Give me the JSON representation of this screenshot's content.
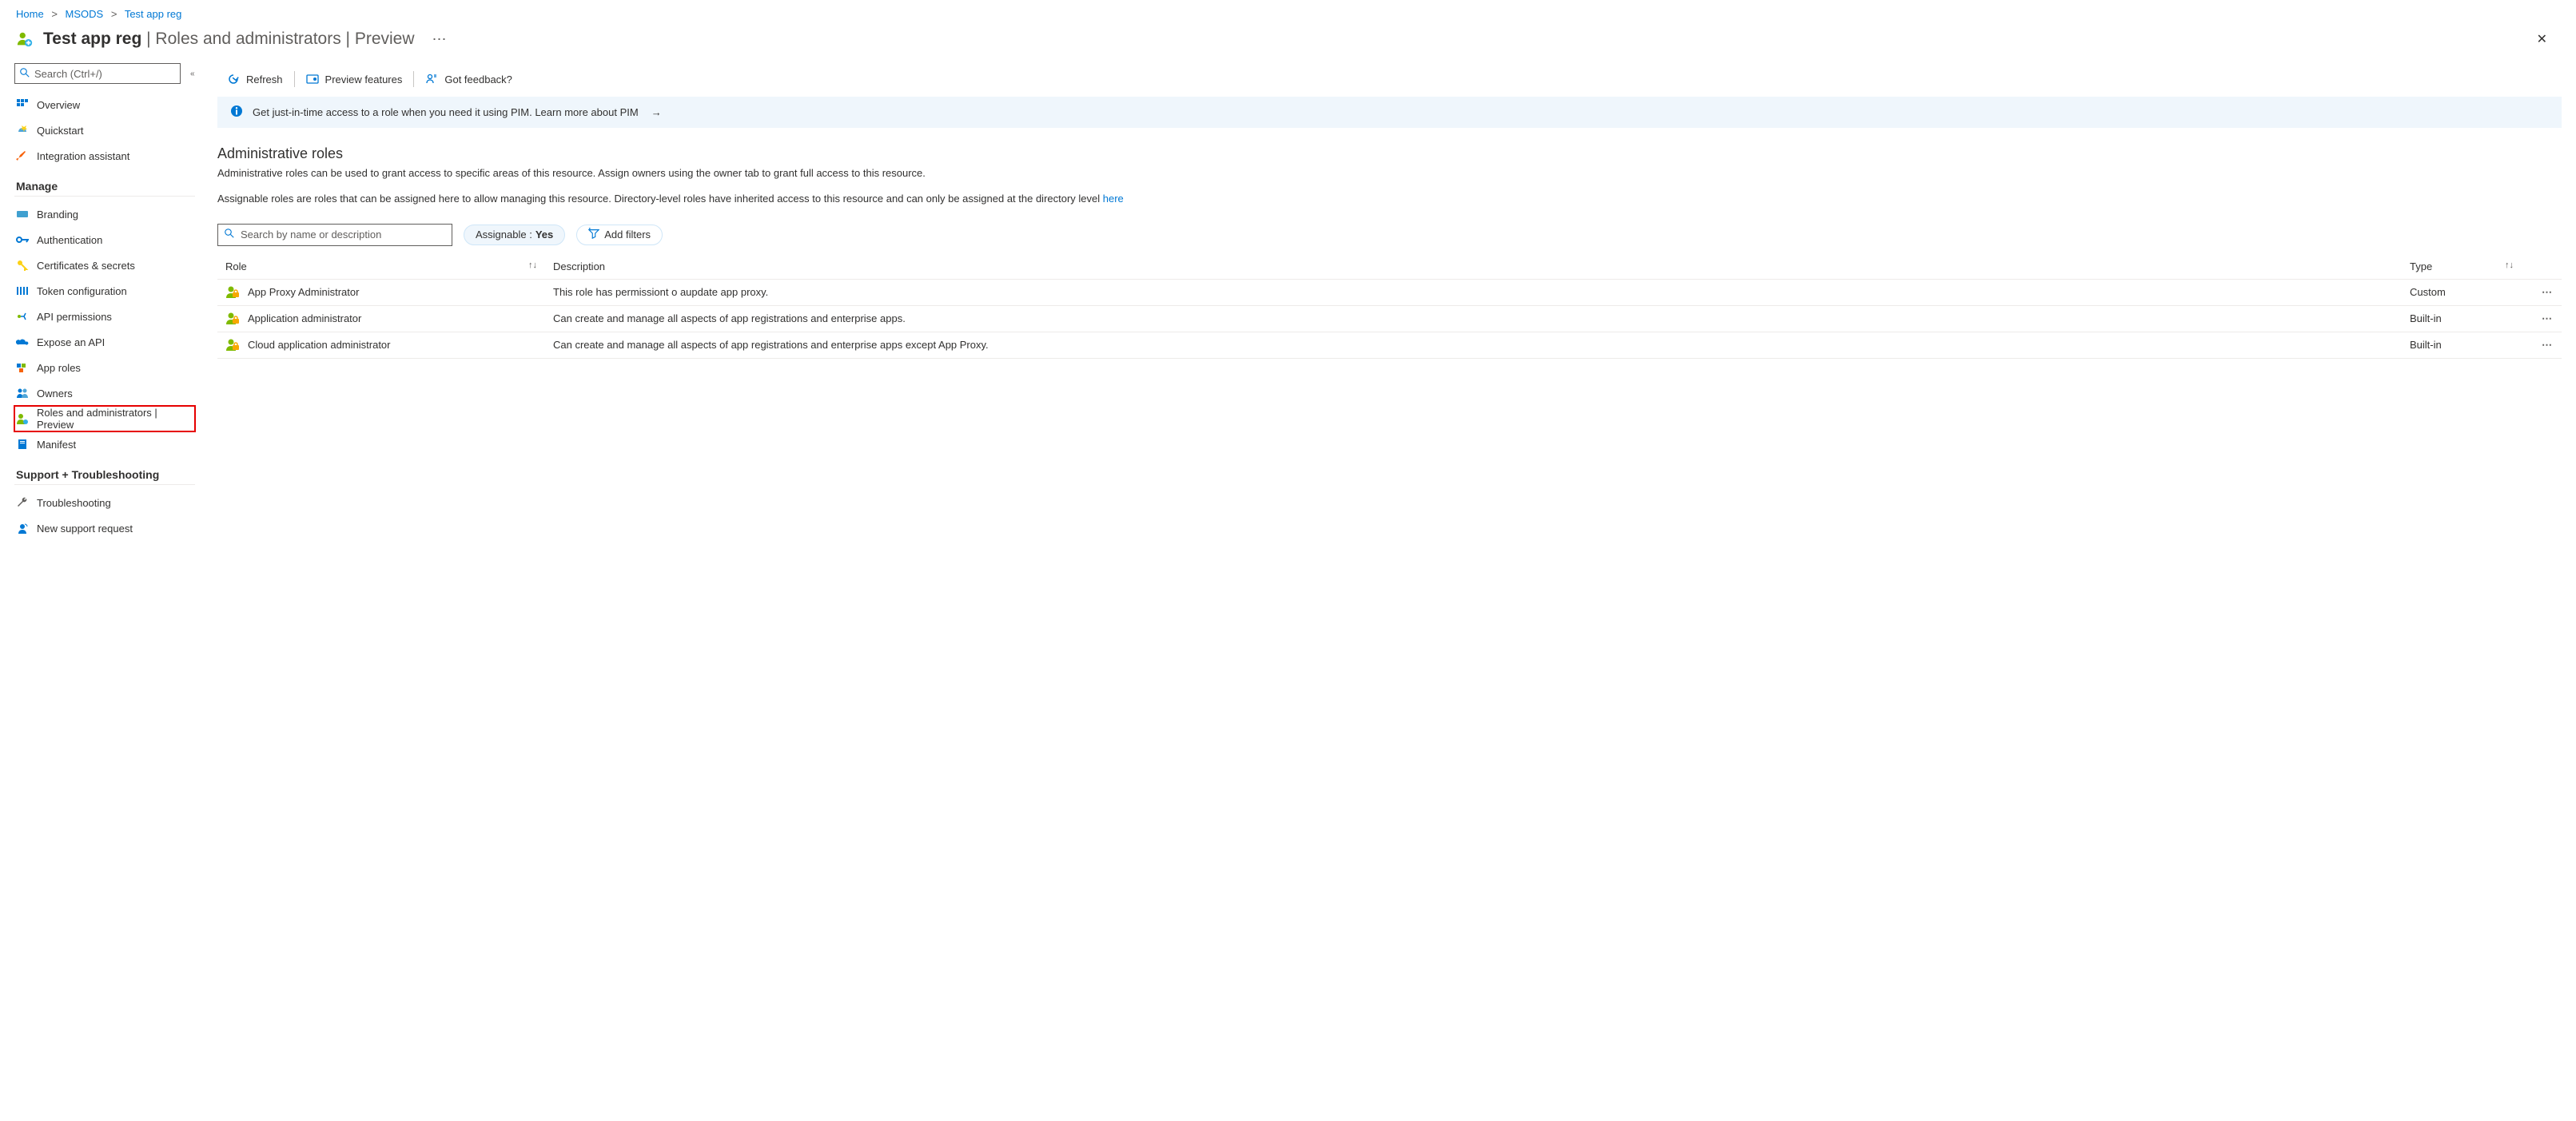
{
  "breadcrumb": {
    "items": [
      "Home",
      "MSODS",
      "Test app reg"
    ]
  },
  "header": {
    "title": "Test app reg",
    "subtitle": " | Roles and administrators | Preview"
  },
  "sidebar": {
    "search_placeholder": "Search (Ctrl+/)",
    "top_items": [
      {
        "label": "Overview",
        "icon": "grid"
      },
      {
        "label": "Quickstart",
        "icon": "rocket-cloud"
      },
      {
        "label": "Integration assistant",
        "icon": "rocket"
      }
    ],
    "section_manage": "Manage",
    "manage_items": [
      {
        "label": "Branding",
        "icon": "tag"
      },
      {
        "label": "Authentication",
        "icon": "key-right"
      },
      {
        "label": "Certificates & secrets",
        "icon": "key"
      },
      {
        "label": "Token configuration",
        "icon": "sliders"
      },
      {
        "label": "API permissions",
        "icon": "api"
      },
      {
        "label": "Expose an API",
        "icon": "cloud"
      },
      {
        "label": "App roles",
        "icon": "roles"
      },
      {
        "label": "Owners",
        "icon": "people"
      },
      {
        "label": "Roles and administrators | Preview",
        "icon": "person-key",
        "highlight": true
      },
      {
        "label": "Manifest",
        "icon": "doc"
      }
    ],
    "section_support": "Support + Troubleshooting",
    "support_items": [
      {
        "label": "Troubleshooting",
        "icon": "wrench"
      },
      {
        "label": "New support request",
        "icon": "support"
      }
    ]
  },
  "commands": {
    "refresh": "Refresh",
    "preview": "Preview features",
    "feedback": "Got feedback?"
  },
  "banner": {
    "text": "Get just-in-time access to a role when you need it using PIM. Learn more about PIM"
  },
  "content": {
    "heading": "Administrative roles",
    "desc1": "Administrative roles can be used to grant access to specific areas of this resource. Assign owners using the owner tab to grant full access to this resource.",
    "desc2_pre": "Assignable roles are roles that can be assigned here to allow managing this resource. Directory-level roles have inherited access to this resource and can only be assigned at the directory level ",
    "desc2_link": "here"
  },
  "filters": {
    "search_placeholder": "Search by name or description",
    "assignable_label": "Assignable :",
    "assignable_value": "Yes",
    "add_filters": "Add filters"
  },
  "table": {
    "headers": {
      "role": "Role",
      "description": "Description",
      "type": "Type"
    },
    "rows": [
      {
        "role": "App Proxy Administrator",
        "description": "This role has permissiont o aupdate app proxy.",
        "type": "Custom"
      },
      {
        "role": "Application administrator",
        "description": "Can create and manage all aspects of app registrations and enterprise apps.",
        "type": "Built-in"
      },
      {
        "role": "Cloud application administrator",
        "description": "Can create and manage all aspects of app registrations and enterprise apps except App Proxy.",
        "type": "Built-in"
      }
    ]
  }
}
